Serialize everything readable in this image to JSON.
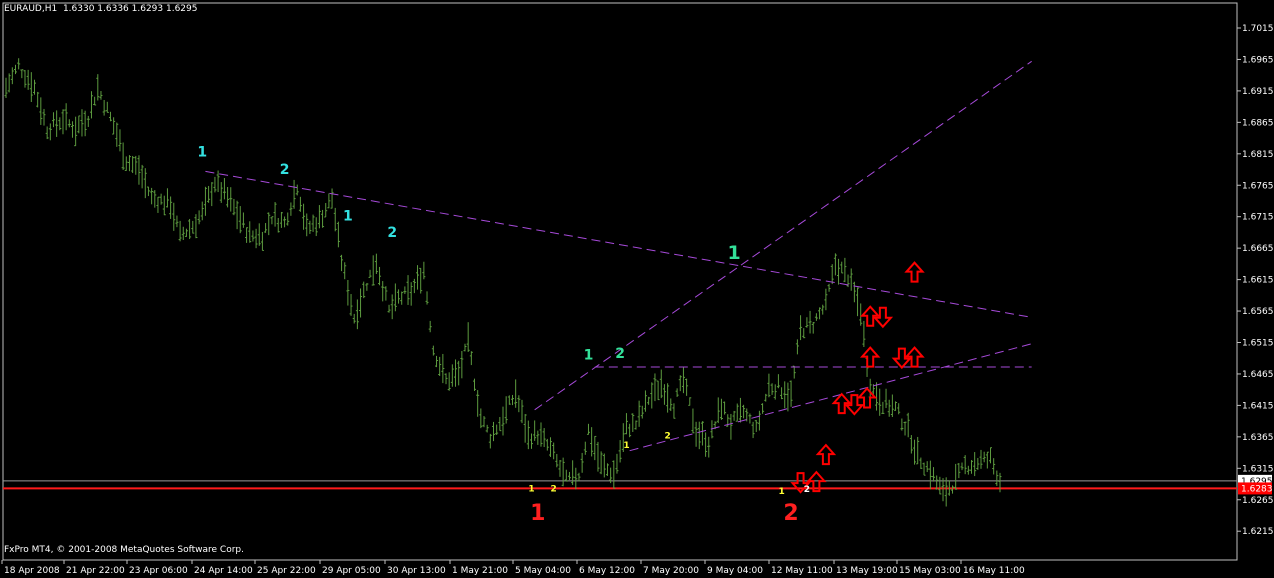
{
  "header": {
    "symbol": "EURAUD,H1",
    "ohlc": "1.6330 1.6336 1.6293 1.6295"
  },
  "footer": {
    "copyright": "FxPro MT4, © 2001-2008 MetaQuotes Software Corp."
  },
  "colors": {
    "background": "#000000",
    "bars": "#5d9b3f",
    "axis": "#c0c0c0",
    "trendlines": "#a64ad9",
    "support_line": "#ff1a1a",
    "arrows": "#ff0000",
    "label_cyan": "#33e0e0",
    "label_green": "#33e099",
    "label_yellow": "#ffff33",
    "label_white": "#ffffff",
    "label_red": "#ff2020"
  },
  "chart_data": {
    "type": "line",
    "title": "EURAUD,H1",
    "y_ticks": [
      "1.7015",
      "1.6965",
      "1.6915",
      "1.6865",
      "1.6815",
      "1.6765",
      "1.6715",
      "1.6665",
      "1.6615",
      "1.6565",
      "1.6515",
      "1.6465",
      "1.6415",
      "1.6365",
      "1.6315",
      "1.6265",
      "1.6215"
    ],
    "x_ticks": [
      "18 Apr 2008",
      "21 Apr 22:00",
      "23 Apr 06:00",
      "24 Apr 14:00",
      "25 Apr 22:00",
      "29 Apr 05:00",
      "30 Apr 13:00",
      "1 May 21:00",
      "5 May 04:00",
      "6 May 12:00",
      "7 May 20:00",
      "9 May 04:00",
      "12 May 11:00",
      "13 May 19:00",
      "15 May 03:00",
      "16 May 11:00"
    ],
    "ylim": [
      1.6197,
      1.706
    ],
    "x_index_range": [
      0,
      314
    ],
    "current_price": "1.6295",
    "support_price": "1.6283",
    "series": [
      {
        "x": [
          0,
          4,
          9,
          13,
          18,
          22,
          26,
          29,
          34,
          38,
          42,
          46,
          52,
          55,
          59,
          62,
          66,
          70,
          73,
          77,
          81,
          84,
          88,
          92,
          95,
          99,
          103,
          106,
          110,
          114,
          117,
          121,
          124,
          128,
          132,
          135,
          139,
          143,
          146,
          150,
          153,
          157,
          161,
          165,
          168,
          172,
          177,
          181,
          184,
          188,
          192,
          196,
          199,
          203,
          207,
          211,
          214,
          218,
          222,
          226,
          229,
          233,
          237,
          241,
          244,
          248,
          251,
          255,
          259,
          262,
          266,
          270,
          273,
          277,
          281,
          285,
          288,
          292,
          296,
          300,
          303,
          307,
          311,
          314
        ],
        "values": [
          1.692,
          1.6955,
          1.692,
          1.6855,
          1.687,
          1.6855,
          1.6875,
          1.692,
          1.686,
          1.6805,
          1.679,
          1.6745,
          1.6735,
          1.6685,
          1.67,
          1.672,
          1.677,
          1.6745,
          1.672,
          1.6685,
          1.6685,
          1.6715,
          1.6705,
          1.6765,
          1.6695,
          1.671,
          1.6745,
          1.6645,
          1.6555,
          1.661,
          1.6645,
          1.6565,
          1.6585,
          1.6595,
          1.663,
          1.6505,
          1.6455,
          1.6465,
          1.6515,
          1.6395,
          1.6365,
          1.6395,
          1.6435,
          1.6365,
          1.637,
          1.6345,
          1.6295,
          1.6305,
          1.6375,
          1.632,
          1.6305,
          1.638,
          1.6385,
          1.6425,
          1.645,
          1.6415,
          1.6455,
          1.6375,
          1.6355,
          1.6415,
          1.6385,
          1.6405,
          1.6375,
          1.6445,
          1.6445,
          1.643,
          1.6535,
          1.6545,
          1.6575,
          1.664,
          1.662,
          1.6565,
          1.6445,
          1.642,
          1.641,
          1.6375,
          1.6335,
          1.631,
          1.6275,
          1.6295,
          1.6318,
          1.6325,
          1.633,
          1.6295
        ]
      }
    ],
    "markers": [
      {
        "text": "1",
        "color": "cyan",
        "i": 62,
        "price": 1.6811,
        "size": "med"
      },
      {
        "text": "2",
        "color": "cyan",
        "i": 88,
        "price": 1.6783,
        "size": "med"
      },
      {
        "text": "1",
        "color": "cyan",
        "i": 108,
        "price": 1.6709,
        "size": "med"
      },
      {
        "text": "2",
        "color": "cyan",
        "i": 122,
        "price": 1.6683,
        "size": "med"
      },
      {
        "text": "1",
        "color": "green",
        "i": 184,
        "price": 1.6488,
        "size": "med"
      },
      {
        "text": "2",
        "color": "green",
        "i": 194,
        "price": 1.649,
        "size": "med"
      },
      {
        "text": "1",
        "color": "green",
        "i": 230,
        "price": 1.6648,
        "size": "big"
      },
      {
        "text": "1",
        "color": "yellow",
        "i": 166,
        "price": 1.6278,
        "size": "small"
      },
      {
        "text": "2",
        "color": "yellow",
        "i": 173,
        "price": 1.6278,
        "size": "small"
      },
      {
        "text": "1",
        "color": "yellow",
        "i": 196,
        "price": 1.6347,
        "size": "small"
      },
      {
        "text": "2",
        "color": "yellow",
        "i": 209,
        "price": 1.6362,
        "size": "small"
      },
      {
        "text": "1",
        "color": "yellow",
        "i": 245,
        "price": 1.6274,
        "size": "small"
      },
      {
        "text": "2",
        "color": "white",
        "i": 253,
        "price": 1.6277,
        "size": "small"
      },
      {
        "text": "1",
        "color": "red",
        "i": 168,
        "price": 1.6233,
        "size": "huge"
      },
      {
        "text": "2",
        "color": "red",
        "i": 248,
        "price": 1.6233,
        "size": "huge"
      }
    ],
    "trendlines": [
      {
        "from": {
          "i": 63,
          "price": 1.6787
        },
        "to": {
          "i": 324,
          "price": 1.6555
        },
        "style": "dashed"
      },
      {
        "from": {
          "i": 167,
          "price": 1.6408
        },
        "to": {
          "i": 324,
          "price": 1.6962
        },
        "style": "dashed"
      },
      {
        "from": {
          "i": 186,
          "price": 1.6476
        },
        "to": {
          "i": 324,
          "price": 1.6476
        },
        "style": "dashed"
      },
      {
        "from": {
          "i": 197,
          "price": 1.6343
        },
        "to": {
          "i": 324,
          "price": 1.6513
        },
        "style": "dashed"
      },
      {
        "from": {
          "i": 0,
          "price": 1.6283
        },
        "to": {
          "i": 324,
          "price": 1.6283
        },
        "style": "solid"
      }
    ],
    "arrows": [
      {
        "dir": "up",
        "i": 287,
        "price": 1.6626
      },
      {
        "dir": "up",
        "i": 273,
        "price": 1.6556
      },
      {
        "dir": "down",
        "i": 277,
        "price": 1.6556
      },
      {
        "dir": "up",
        "i": 273,
        "price": 1.6491
      },
      {
        "dir": "down",
        "i": 283,
        "price": 1.6491
      },
      {
        "dir": "up",
        "i": 287,
        "price": 1.6491
      },
      {
        "dir": "up",
        "i": 264,
        "price": 1.6417
      },
      {
        "dir": "down",
        "i": 268,
        "price": 1.6417
      },
      {
        "dir": "up",
        "i": 272,
        "price": 1.6426
      },
      {
        "dir": "up",
        "i": 259,
        "price": 1.6336
      },
      {
        "dir": "down",
        "i": 251,
        "price": 1.6293
      },
      {
        "dir": "up",
        "i": 256,
        "price": 1.6293
      }
    ]
  }
}
